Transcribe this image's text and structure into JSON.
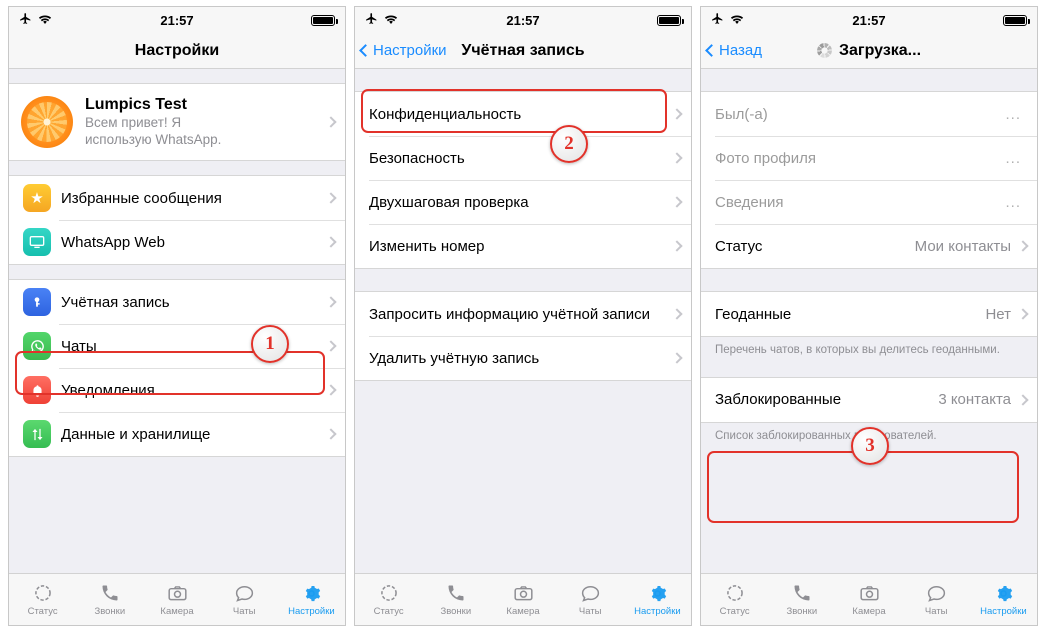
{
  "status_bar": {
    "time": "21:57",
    "airplane_icon": "airplane-icon",
    "wifi_icon": "wifi-icon",
    "battery_icon": "battery-full-icon"
  },
  "screen1": {
    "nav": {
      "title": "Настройки"
    },
    "profile": {
      "name": "Lumpics Test",
      "status_line1": "Всем привет! Я",
      "status_line2": "использую WhatsApp."
    },
    "group1": [
      {
        "label": "Избранные сообщения",
        "icon": "star-icon"
      },
      {
        "label": "WhatsApp Web",
        "icon": "monitor-icon"
      }
    ],
    "group2": [
      {
        "label": "Учётная запись",
        "icon": "key-icon"
      },
      {
        "label": "Чаты",
        "icon": "whatsapp-icon"
      },
      {
        "label": "Уведомления",
        "icon": "bell-icon"
      },
      {
        "label": "Данные и хранилище",
        "icon": "arrows-updown-icon"
      }
    ],
    "annotation": {
      "number": "1"
    }
  },
  "screen2": {
    "nav": {
      "back": "Настройки",
      "title": "Учётная запись"
    },
    "group1": [
      {
        "label": "Конфиденциальность"
      },
      {
        "label": "Безопасность"
      },
      {
        "label": "Двухшаговая проверка"
      },
      {
        "label": "Изменить номер"
      }
    ],
    "group2": [
      {
        "label": "Запросить информацию учётной записи"
      },
      {
        "label": "Удалить учётную запись"
      }
    ],
    "annotation": {
      "number": "2"
    }
  },
  "screen3": {
    "nav": {
      "back": "Назад",
      "title": "Загрузка...",
      "spinner": "loading-spinner-icon"
    },
    "group1": [
      {
        "label": "Был(-а)",
        "value": "...",
        "muted": true
      },
      {
        "label": "Фото профиля",
        "value": "...",
        "muted": true
      },
      {
        "label": "Сведения",
        "value": "...",
        "muted": true
      },
      {
        "label": "Статус",
        "value": "Мои контакты",
        "muted": false
      }
    ],
    "group2": [
      {
        "label": "Геоданные",
        "value": "Нет",
        "muted": false
      }
    ],
    "footnote": "Перечень чатов, в которых вы делитесь геоданными.",
    "group3": [
      {
        "label": "Заблокированные",
        "value": "3 контакта",
        "muted": false
      }
    ],
    "footnote2": "Список заблокированных пользователей.",
    "annotation": {
      "number": "3"
    }
  },
  "tabbar": {
    "items": [
      {
        "label": "Статус",
        "icon": "status-ring-icon",
        "active": false
      },
      {
        "label": "Звонки",
        "icon": "phone-icon",
        "active": false
      },
      {
        "label": "Камера",
        "icon": "camera-icon",
        "active": false
      },
      {
        "label": "Чаты",
        "icon": "chat-bubble-icon",
        "active": false
      },
      {
        "label": "Настройки",
        "icon": "gear-icon",
        "active": true
      }
    ]
  },
  "colors": {
    "accent_blue": "#1a9cf0",
    "annotation_red": "#e2322a",
    "group_bg": "#efeff4"
  }
}
